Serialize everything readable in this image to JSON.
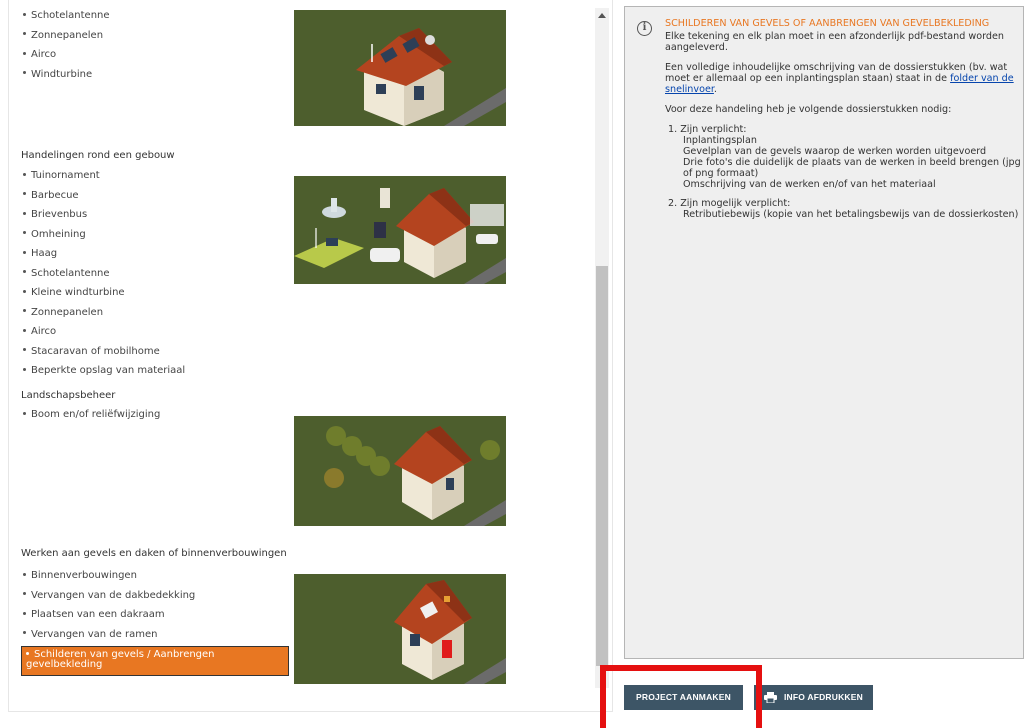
{
  "categories": [
    {
      "title": "",
      "items": [
        "Schotelantenne",
        "Zonnepanelen",
        "Airco",
        "Windturbine"
      ]
    },
    {
      "title": "Handelingen rond een gebouw",
      "items": [
        "Tuinornament",
        "Barbecue",
        "Brievenbus",
        "Omheining",
        "Haag",
        "Schotelantenne",
        "Kleine windturbine",
        "Zonnepanelen",
        "Airco",
        "Stacaravan of mobilhome",
        "Beperkte opslag van materiaal"
      ]
    },
    {
      "title": "Landschapsbeheer",
      "items": [
        "Boom en/of reliëfwijziging"
      ]
    },
    {
      "title": "Werken aan gevels en daken of binnenverbouwingen",
      "items": [
        "Binnenverbouwingen",
        "Vervangen van de dakbedekking",
        "Plaatsen van een dakraam",
        "Vervangen van de ramen",
        "Schilderen van gevels / Aanbrengen gevelbekleding"
      ],
      "selected_index": 4
    }
  ],
  "info": {
    "title": "Schilderen van gevels of aanbrengen van gevelbekleding",
    "p1": "Elke tekening en elk plan moet in een afzonderlijk pdf-bestand worden aangeleverd.",
    "p2_before": "Een volledige inhoudelijke omschrijving van de dossierstukken (bv. wat moet er allemaal op een inplantingsplan staan) staat in de ",
    "p2_link": "folder van de snelinvoer",
    "p2_after": ".",
    "p3": "Voor deze handeling heb je volgende dossierstukken nodig:",
    "required_head": "1. Zijn verplicht:",
    "required_items": [
      "Inplantingsplan",
      "Gevelplan van de gevels waarop de werken worden uitgevoerd",
      "Drie foto's die duidelijk de plaats van de werken in beeld brengen (jpg of png formaat)",
      "Omschrijving van de werken en/of van het materiaal"
    ],
    "maybe_head": "2. Zijn mogelijk verplicht:",
    "maybe_items": [
      "Retributiebewijs (kopie van het betalingsbewijs van de dossierkosten)"
    ]
  },
  "buttons": {
    "create": "Project aanmaken",
    "print": "Info afdrukken"
  },
  "colors": {
    "accent": "#e87722",
    "button": "#3d5566",
    "highlight": "#e51010",
    "illustration_bg": "#4d5e2d"
  }
}
